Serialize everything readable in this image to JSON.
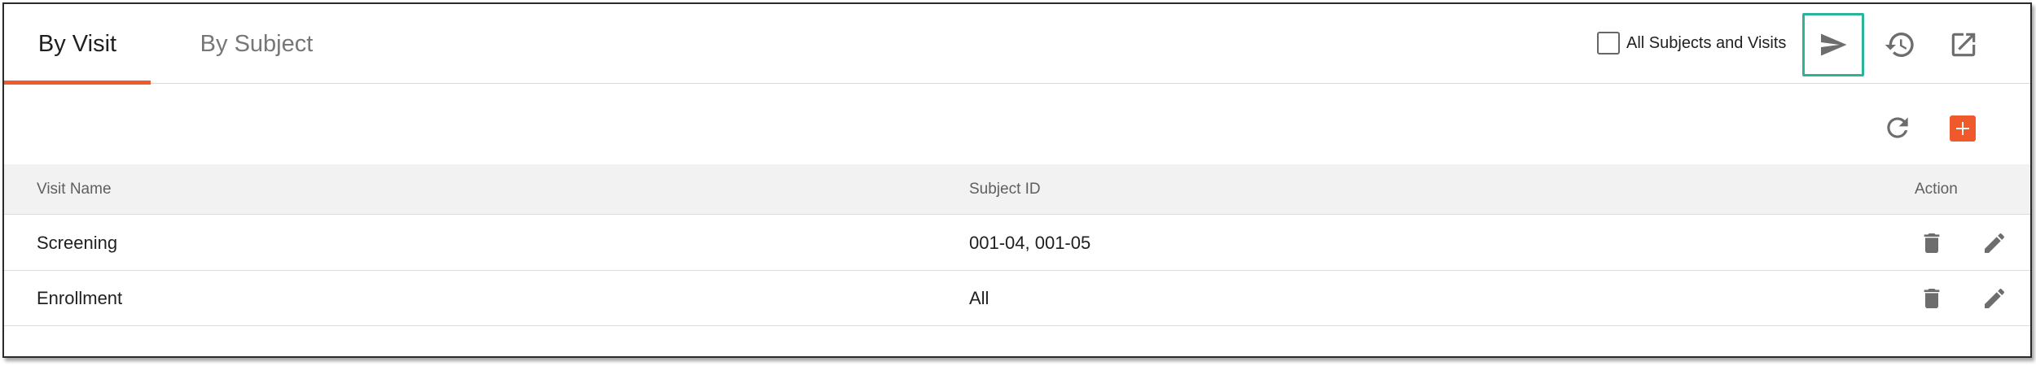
{
  "tabs": [
    {
      "label": "By Visit",
      "active": true
    },
    {
      "label": "By Subject",
      "active": false
    }
  ],
  "header": {
    "checkbox_label": "All Subjects and Visits",
    "checkbox_checked": false,
    "icons": [
      "send-icon",
      "history-icon",
      "open-in-new-icon"
    ]
  },
  "toolbar": {
    "icons": [
      "refresh-icon",
      "add-icon"
    ]
  },
  "table": {
    "columns": [
      "Visit Name",
      "Subject ID",
      "Action"
    ],
    "rows": [
      {
        "visit_name": "Screening",
        "subject_id": "001-04, 001-05"
      },
      {
        "visit_name": "Enrollment",
        "subject_id": "All"
      }
    ],
    "row_actions": [
      "delete-icon",
      "edit-icon"
    ]
  },
  "colors": {
    "accent": "#f0592b",
    "highlight": "#2ab49a",
    "icon": "#6d6d6d"
  }
}
